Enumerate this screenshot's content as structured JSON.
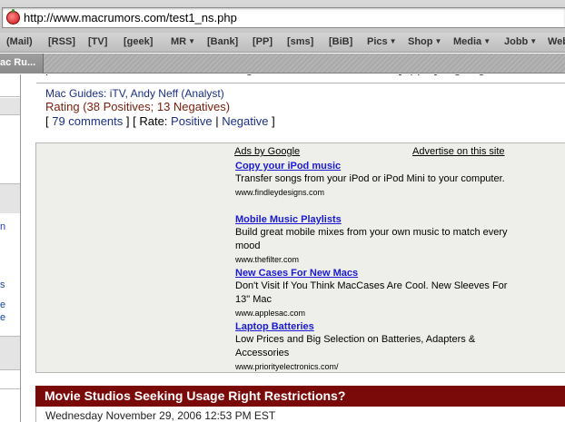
{
  "browser": {
    "url": "http://www.macrumors.com/test1_ns.php",
    "active_tab_label": "ac Ru..."
  },
  "bookmarks": [
    {
      "label": "(Mail)",
      "dropdown": false
    },
    {
      "label": "[RSS]",
      "dropdown": false
    },
    {
      "label": "[TV]",
      "dropdown": false
    },
    {
      "label": "[geek]",
      "dropdown": false
    },
    {
      "label": "MR",
      "dropdown": true
    },
    {
      "label": "[Bank]",
      "dropdown": false
    },
    {
      "label": "[PP]",
      "dropdown": false
    },
    {
      "label": "[sms]",
      "dropdown": false
    },
    {
      "label": "[BiB]",
      "dropdown": false
    },
    {
      "label": "Pics",
      "dropdown": true
    },
    {
      "label": "Shop",
      "dropdown": true
    },
    {
      "label": "Media",
      "dropdown": true
    },
    {
      "label": "Jobb",
      "dropdown": true
    },
    {
      "label": "Web",
      "dropdown": false
    }
  ],
  "left_column": {
    "letters": [
      "n",
      "s",
      "e",
      "e"
    ]
  },
  "article": {
    "cut_text": "pocket\", and hinted that that theme gave a \"little idea of where [Apple] is going.\"",
    "mac_guides_prefix": "Mac Guides: ",
    "mac_guides_links": "iTV, Andy Neff (Analyst)",
    "rating": "Rating (38 Positives; 13 Negatives)",
    "comments_link": "79 comments",
    "rate_label": "Rate:",
    "rate_positive": "Positive",
    "rate_negative": "Negative"
  },
  "ads": {
    "header_left": "Ads by Google",
    "header_right": "Advertise on this site",
    "items": [
      {
        "title": "Copy your iPod music",
        "description": "Transfer songs from your iPod or iPod Mini to your computer.",
        "url": "www.findleydesigns.com"
      },
      {
        "title": "Mobile Music Playlists",
        "description": "Build great mobile mixes from your own music to match every mood",
        "url": "www.thefilter.com"
      },
      {
        "title": "New Cases For New Macs",
        "description": "Don't Visit If You Think MacCases Are Cool. New Sleeves For 13\" Mac",
        "url": "www.applesac.com"
      },
      {
        "title": "Laptop Batteries",
        "description": "Low Prices and Big Selection on Batteries, Adapters & Accessories",
        "url": "www.priorityelectronics.com/"
      }
    ]
  },
  "story": {
    "title": "Movie Studios Seeking Usage Right Restrictions?",
    "date": "Wednesday November 29, 2006 12:53 PM EST"
  },
  "colors": {
    "story_header_bg": "#7a0a0a",
    "ad_link": "#1a1ad4",
    "rating_text": "#7a1d0c",
    "article_link": "#1a2f86"
  }
}
